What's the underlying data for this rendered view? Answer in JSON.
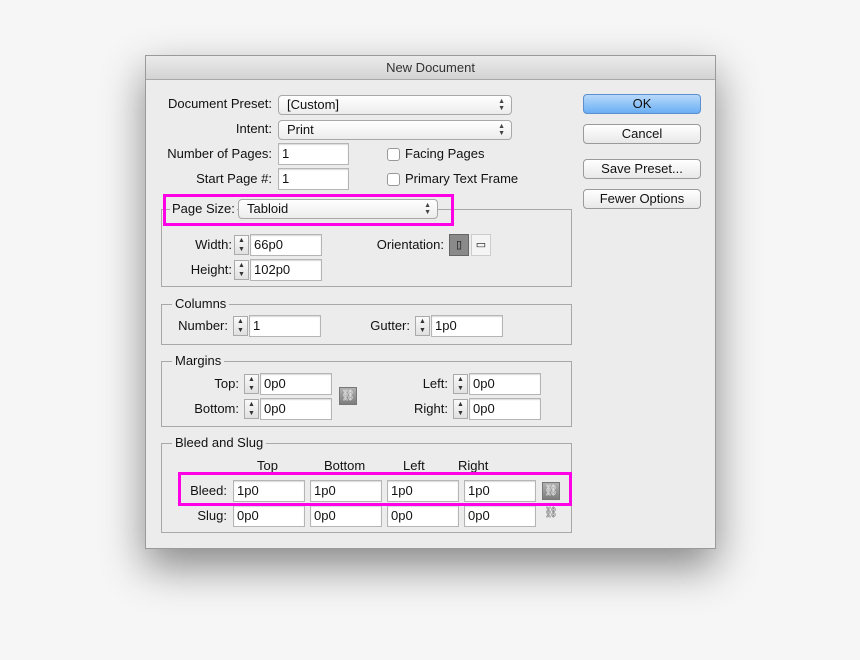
{
  "title": "New Document",
  "preset": {
    "label": "Document Preset:",
    "value": "[Custom]"
  },
  "intent": {
    "label": "Intent:",
    "value": "Print"
  },
  "num_pages": {
    "label": "Number of Pages:",
    "value": "1"
  },
  "start_page": {
    "label": "Start Page #:",
    "value": "1"
  },
  "facing_pages": {
    "label": "Facing Pages",
    "checked": false
  },
  "primary_text_frame": {
    "label": "Primary Text Frame",
    "checked": false
  },
  "page_size": {
    "label": "Page Size:",
    "value": "Tabloid",
    "width_label": "Width:",
    "width": "66p0",
    "height_label": "Height:",
    "height": "102p0",
    "orientation_label": "Orientation:",
    "orientation": "portrait"
  },
  "columns": {
    "title": "Columns",
    "number_label": "Number:",
    "number": "1",
    "gutter_label": "Gutter:",
    "gutter": "1p0"
  },
  "margins": {
    "title": "Margins",
    "top_label": "Top:",
    "top": "0p0",
    "bottom_label": "Bottom:",
    "bottom": "0p0",
    "left_label": "Left:",
    "left": "0p0",
    "right_label": "Right:",
    "right": "0p0"
  },
  "bleed_slug": {
    "title": "Bleed and Slug",
    "headers": [
      "Top",
      "Bottom",
      "Left",
      "Right"
    ],
    "bleed_label": "Bleed:",
    "bleed": [
      "1p0",
      "1p0",
      "1p0",
      "1p0"
    ],
    "slug_label": "Slug:",
    "slug": [
      "0p0",
      "0p0",
      "0p0",
      "0p0"
    ]
  },
  "buttons": {
    "ok": "OK",
    "cancel": "Cancel",
    "save_preset": "Save Preset...",
    "fewer_options": "Fewer Options"
  },
  "highlight_color": "#ff00e6"
}
